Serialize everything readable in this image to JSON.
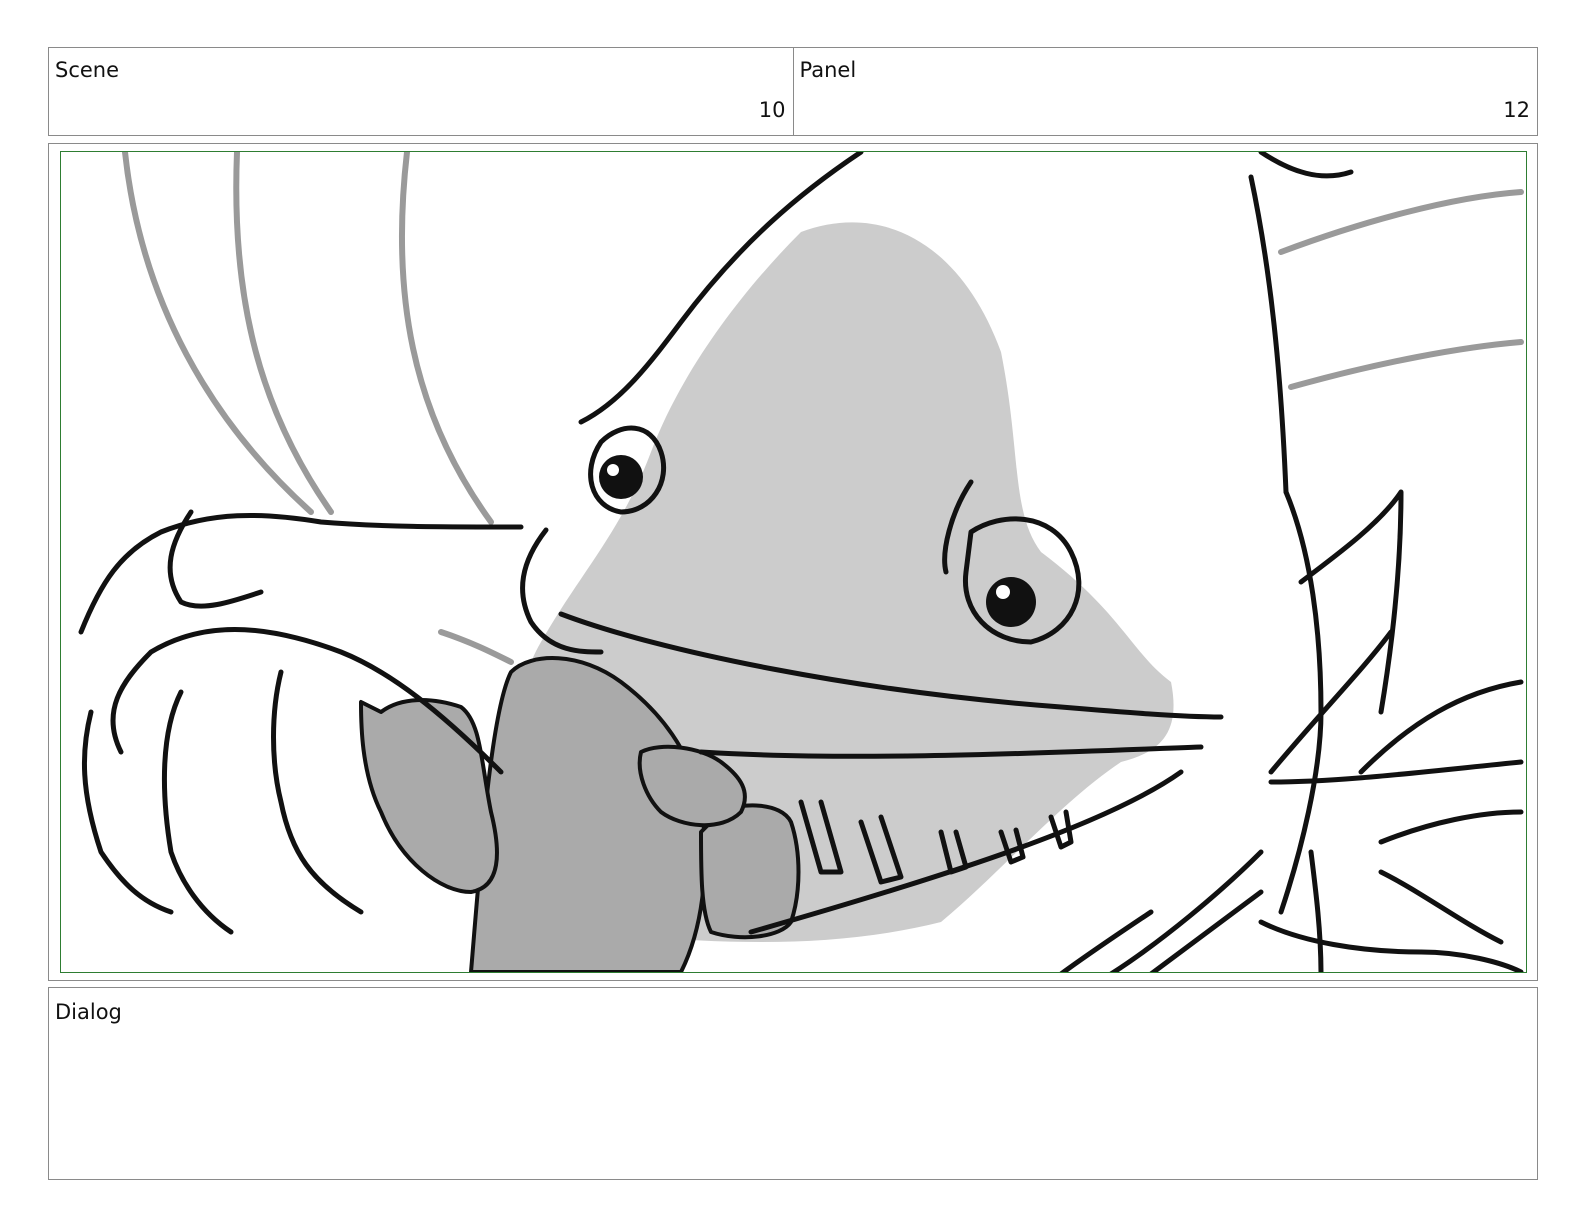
{
  "header": {
    "scene_label": "Scene",
    "scene_value": "10",
    "panel_label": "Panel",
    "panel_value": "12"
  },
  "dialog": {
    "label": "Dialog",
    "text": ""
  }
}
